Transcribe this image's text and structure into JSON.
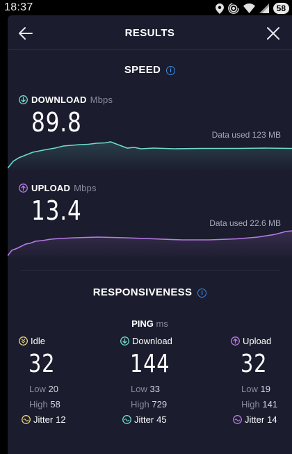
{
  "status_bar": {
    "time": "18:37",
    "battery": "58",
    "icons": [
      "location-icon",
      "hotspot-icon",
      "wifi-icon",
      "signal-icon"
    ]
  },
  "header": {
    "title": "RESULTS",
    "back_icon": "arrow-left-icon",
    "close_icon": "close-icon"
  },
  "speed": {
    "title": "SPEED",
    "download": {
      "label": "DOWNLOAD",
      "unit": "Mbps",
      "value": "89.8",
      "data_used": "Data used 123 MB",
      "color": "#6fdbd0"
    },
    "upload": {
      "label": "UPLOAD",
      "unit": "Mbps",
      "value": "13.4",
      "data_used": "Data used 22.6 MB",
      "color": "#b87be8"
    }
  },
  "responsiveness": {
    "title": "RESPONSIVENESS",
    "ping_label": "PING",
    "ping_unit": "ms",
    "columns": [
      {
        "label": "Idle",
        "value": "32",
        "low_label": "Low",
        "low": "20",
        "high_label": "High",
        "high": "58",
        "jitter_label": "Jitter",
        "jitter": "12",
        "color": "#e8d47a"
      },
      {
        "label": "Download",
        "value": "144",
        "low_label": "Low",
        "low": "33",
        "high_label": "High",
        "high": "729",
        "jitter_label": "Jitter",
        "jitter": "45",
        "color": "#6fdbd0"
      },
      {
        "label": "Upload",
        "value": "32",
        "low_label": "Low",
        "low": "19",
        "high_label": "High",
        "high": "141",
        "jitter_label": "Jitter",
        "jitter": "14",
        "color": "#b87be8"
      }
    ]
  }
}
